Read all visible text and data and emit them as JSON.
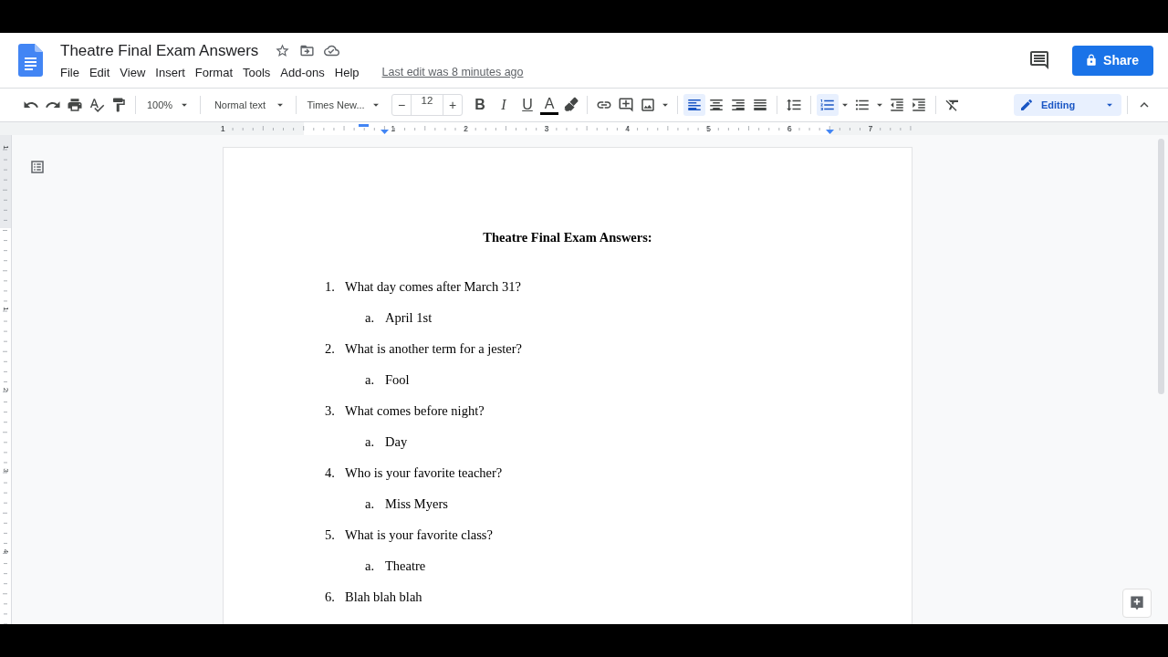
{
  "document": {
    "title": "Theatre Final Exam Answers",
    "last_edit": "Last edit was 8 minutes ago"
  },
  "menu": [
    "File",
    "Edit",
    "View",
    "Insert",
    "Format",
    "Tools",
    "Add-ons",
    "Help"
  ],
  "share": {
    "label": "Share"
  },
  "toolbar": {
    "zoom": "100%",
    "style": "Normal text",
    "font": "Times New...",
    "font_size": "12",
    "minus": "−",
    "plus": "+",
    "format_buttons": [
      {
        "label": "B"
      },
      {
        "label": "I"
      },
      {
        "label": "U"
      },
      {
        "label": "A"
      }
    ],
    "alignment": [
      {
        "selected": true
      },
      {
        "selected": false
      },
      {
        "selected": false
      },
      {
        "selected": false
      }
    ],
    "lists": [
      {
        "selected": true
      },
      {
        "selected": false
      }
    ],
    "mode": "Editing"
  },
  "ruler": {
    "labels": [
      "1",
      "1",
      "2",
      "3",
      "4",
      "5",
      "6",
      "7"
    ]
  },
  "vertical_ruler": {
    "labels": [
      "1",
      "1",
      "2",
      "3",
      "4"
    ]
  },
  "page": {
    "heading": "Theatre Final Exam Answers:",
    "questions": [
      {
        "number": "1.",
        "text": "What day comes after March 31?",
        "answers": [
          {
            "marker": "a.",
            "text": "April 1st"
          }
        ]
      },
      {
        "number": "2.",
        "text": "What is another term for a jester?",
        "answers": [
          {
            "marker": "a.",
            "text": "Fool"
          }
        ]
      },
      {
        "number": "3.",
        "text": "What comes before night?",
        "answers": [
          {
            "marker": "a.",
            "text": "Day"
          }
        ]
      },
      {
        "number": "4.",
        "text": "Who is your favorite teacher?",
        "answers": [
          {
            "marker": "a.",
            "text": "Miss Myers"
          }
        ]
      },
      {
        "number": "5.",
        "text": "What is your favorite class?",
        "answers": [
          {
            "marker": "a.",
            "text": "Theatre"
          }
        ]
      },
      {
        "number": "6.",
        "text": "Blah blah blah"
      }
    ]
  }
}
